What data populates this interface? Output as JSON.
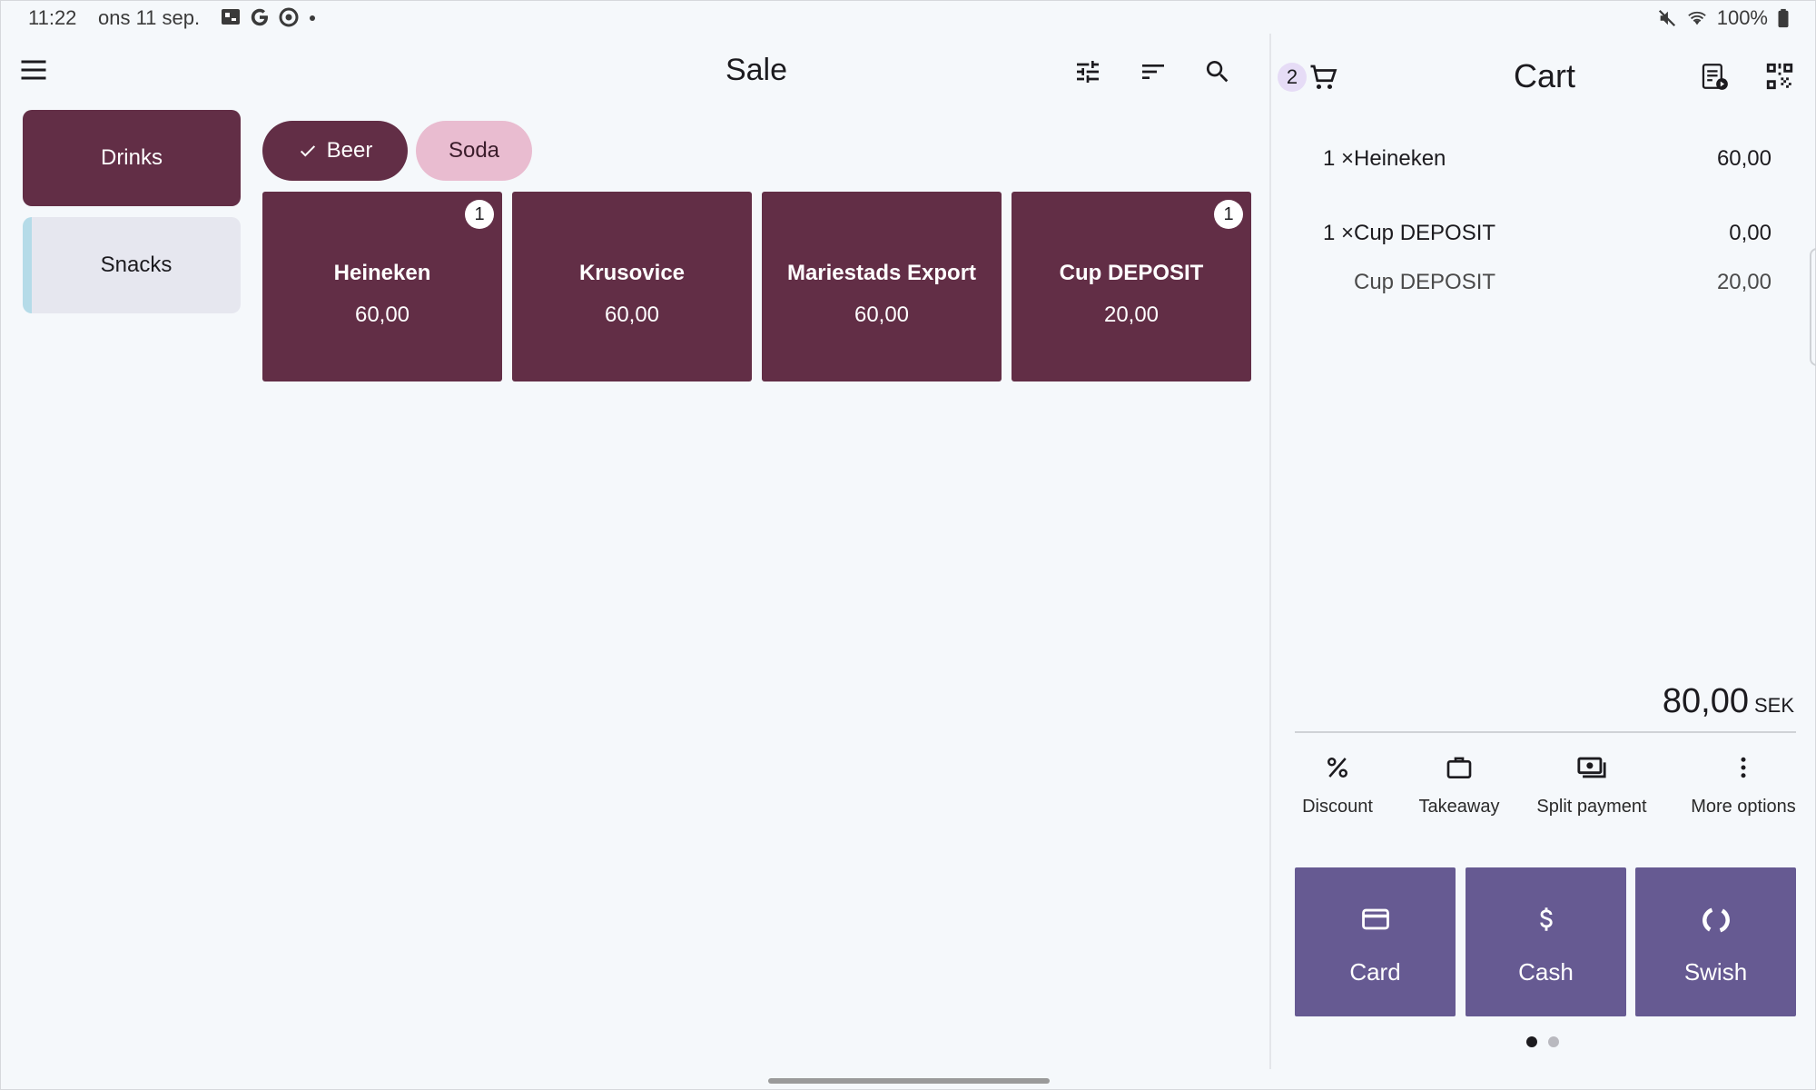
{
  "status_bar": {
    "time": "11:22",
    "date": "ons 11 sep.",
    "battery": "100%",
    "icons": [
      "notification-app-icon",
      "google-g-icon",
      "circle-app-icon",
      "dot-icon",
      "mute-icon",
      "wifi-icon",
      "battery-icon"
    ]
  },
  "sale": {
    "title": "Sale",
    "tools": [
      "tune-icon",
      "sort-icon",
      "search-icon"
    ],
    "categories": [
      {
        "label": "Drinks",
        "selected": true
      },
      {
        "label": "Snacks",
        "selected": false
      }
    ],
    "subcategories": [
      {
        "label": "Beer",
        "selected": true
      },
      {
        "label": "Soda",
        "selected": false
      }
    ],
    "products": [
      {
        "name": "Heineken",
        "price": "60,00",
        "badge": "1"
      },
      {
        "name": "Krusovice",
        "price": "60,00",
        "badge": ""
      },
      {
        "name": "Mariestads Export",
        "price": "60,00",
        "badge": ""
      },
      {
        "name": "Cup DEPOSIT",
        "price": "20,00",
        "badge": "1"
      }
    ]
  },
  "cart": {
    "count": "2",
    "title": "Cart",
    "lines": [
      {
        "qty": "1 ×",
        "name": "Heineken",
        "price": "60,00"
      },
      {
        "qty": "1 ×",
        "name": "Cup DEPOSIT",
        "price": "0,00"
      },
      {
        "qty": "",
        "name": "Cup DEPOSIT",
        "price": "20,00"
      }
    ],
    "total": "80,00",
    "currency": "SEK",
    "actions": [
      {
        "label": "Discount",
        "icon": "percent-icon"
      },
      {
        "label": "Takeaway",
        "icon": "briefcase-icon"
      },
      {
        "label": "Split payment",
        "icon": "payments-icon"
      },
      {
        "label": "More options",
        "icon": "more-vert-icon"
      }
    ],
    "payments": [
      {
        "label": "Card",
        "icon": "credit-card-icon"
      },
      {
        "label": "Cash",
        "icon": "dollar-icon"
      },
      {
        "label": "Swish",
        "icon": "swish-icon"
      }
    ]
  },
  "colors": {
    "primary": "#622e46",
    "chip_unselected": "#e9bcd0",
    "payment": "#665a92",
    "background": "#f5f8fb"
  }
}
